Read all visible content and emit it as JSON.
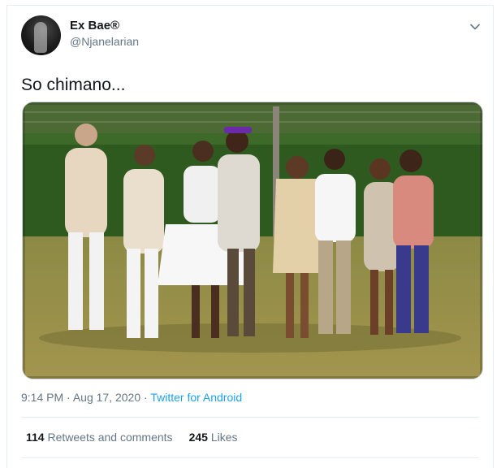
{
  "tweet": {
    "display_name": "Ex Bae®",
    "handle": "@Njanelarian",
    "text": "So chimano...",
    "time": "9:14 PM",
    "separator": "·",
    "date": "Aug 17, 2020",
    "source": "Twitter for Android"
  },
  "stats": {
    "retweets_count": "114",
    "retweets_label": "Retweets and comments",
    "likes_count": "245",
    "likes_label": "Likes"
  },
  "icons": {
    "menu": "chevron-down-icon",
    "avatar": "profile-avatar"
  },
  "colors": {
    "link": "#1da1f2",
    "secondary_text": "#657786",
    "primary_text": "#14171a",
    "border": "#e6ecf0"
  }
}
